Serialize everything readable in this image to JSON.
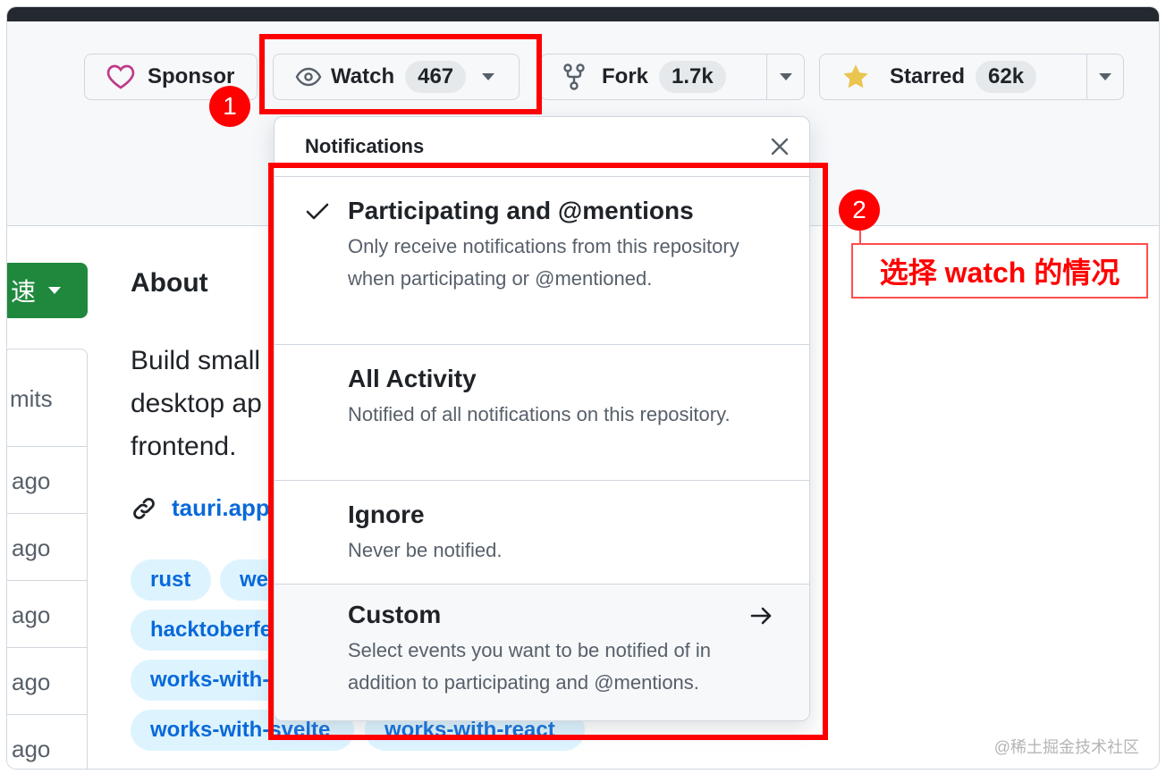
{
  "header": {
    "sponsor": {
      "label": "Sponsor",
      "icon": "heart-icon"
    },
    "watch": {
      "label": "Watch",
      "count": "467",
      "icon": "eye-icon"
    },
    "fork": {
      "label": "Fork",
      "count": "1.7k",
      "icon": "repo-forked-icon"
    },
    "starred": {
      "label": "Starred",
      "count": "62k",
      "icon": "star-fill-icon"
    }
  },
  "annotations": {
    "badge1": "1",
    "badge2": "2",
    "note": "选择 watch 的情况"
  },
  "dropdown": {
    "title": "Notifications",
    "options": [
      {
        "title": "Participating and @mentions",
        "desc": "Only receive notifications from this repository when participating or @mentioned.",
        "selected": true
      },
      {
        "title": "All Activity",
        "desc": "Notified of all notifications on this repository."
      },
      {
        "title": "Ignore",
        "desc": "Never be notified."
      },
      {
        "title": "Custom",
        "desc": "Select events you want to be notified of in addition to participating and @mentions."
      }
    ]
  },
  "about": {
    "title": "About",
    "text_lines": [
      "Build small",
      "desktop ap",
      "frontend."
    ],
    "link": "tauri.app"
  },
  "topics": [
    "rust",
    "we",
    "hacktoberfe",
    "works-with-",
    "works-with-svelte",
    "works-with-react"
  ],
  "left": {
    "code_button": "速",
    "commits": "mits",
    "ago": [
      "ago",
      "ago",
      "ago",
      "ago",
      "ago"
    ]
  },
  "watermark": "@稀土掘金技术社区",
  "colors": {
    "accent": "#0969da",
    "annotation": "#ff0000",
    "green": "#1f883d"
  }
}
